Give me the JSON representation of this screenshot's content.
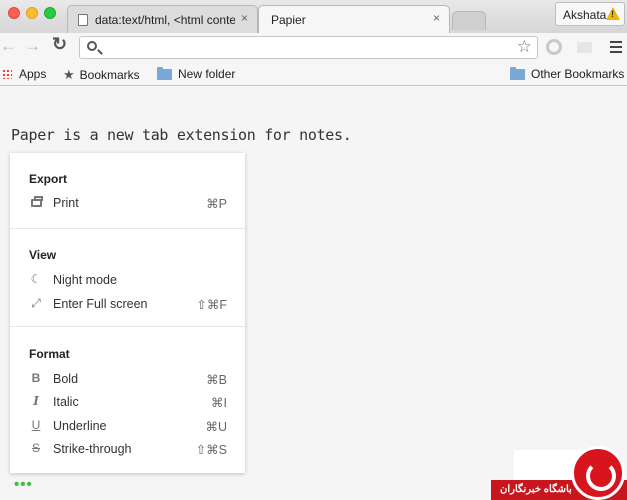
{
  "browser": {
    "tabs": [
      {
        "title": "data:text/html, <html conte",
        "close": "×"
      },
      {
        "title": "Papier",
        "close": "×"
      }
    ],
    "profile_name": "Akshata",
    "nav": {
      "back": "←",
      "forward": "→",
      "reload": "C"
    },
    "star": "☆",
    "bookmarks_bar": {
      "apps": "Apps",
      "bookmarks": "Bookmarks",
      "new_folder": "New folder",
      "other": "Other Bookmarks"
    }
  },
  "page": {
    "headline": "Paper is a new tab extension for notes.",
    "menu": {
      "sections": [
        {
          "title": "Export",
          "items": [
            {
              "label": "Print",
              "shortcut": "⌘P",
              "icon": "printer-icon"
            }
          ]
        },
        {
          "title": "View",
          "items": [
            {
              "label": "Night mode",
              "shortcut": "",
              "icon": "moon-icon"
            },
            {
              "label": "Enter Full screen",
              "shortcut": "⇧⌘F",
              "icon": "fullscreen-icon"
            }
          ]
        },
        {
          "title": "Format",
          "items": [
            {
              "label": "Bold",
              "shortcut": "⌘B",
              "icon": "bold-icon",
              "glyph": "B"
            },
            {
              "label": "Italic",
              "shortcut": "⌘I",
              "icon": "italic-icon",
              "glyph": "I"
            },
            {
              "label": "Underline",
              "shortcut": "⌘U",
              "icon": "underline-icon",
              "glyph": "U"
            },
            {
              "label": "Strike-through",
              "shortcut": "⇧⌘S",
              "icon": "strikethrough-icon",
              "glyph": "S"
            }
          ]
        }
      ]
    },
    "menu_toggle": "•••"
  },
  "watermark": {
    "text": "باشگاه خبرنگاران"
  },
  "colors": {
    "accent_green": "#3ebf3e",
    "watermark_red": "#c8161e"
  }
}
